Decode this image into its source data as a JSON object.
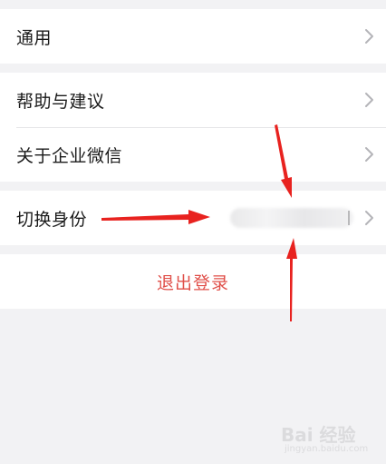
{
  "settings": {
    "general": {
      "label": "通用"
    },
    "help": {
      "label": "帮助与建议"
    },
    "about": {
      "label": "关于企业微信"
    },
    "switch_identity": {
      "label": "切换身份",
      "value": ""
    }
  },
  "logout": {
    "label": "退出登录"
  },
  "colors": {
    "background": "#f2f2f4",
    "row_background": "#ffffff",
    "logout_text": "#e0504a",
    "arrow": "#e8221f"
  },
  "icons": {
    "chevron": "chevron-right-icon",
    "annotation_arrow": "red-arrow-icon"
  },
  "watermark": {
    "text": "Bai 经验",
    "sub": "jingyan.baidu.com"
  }
}
